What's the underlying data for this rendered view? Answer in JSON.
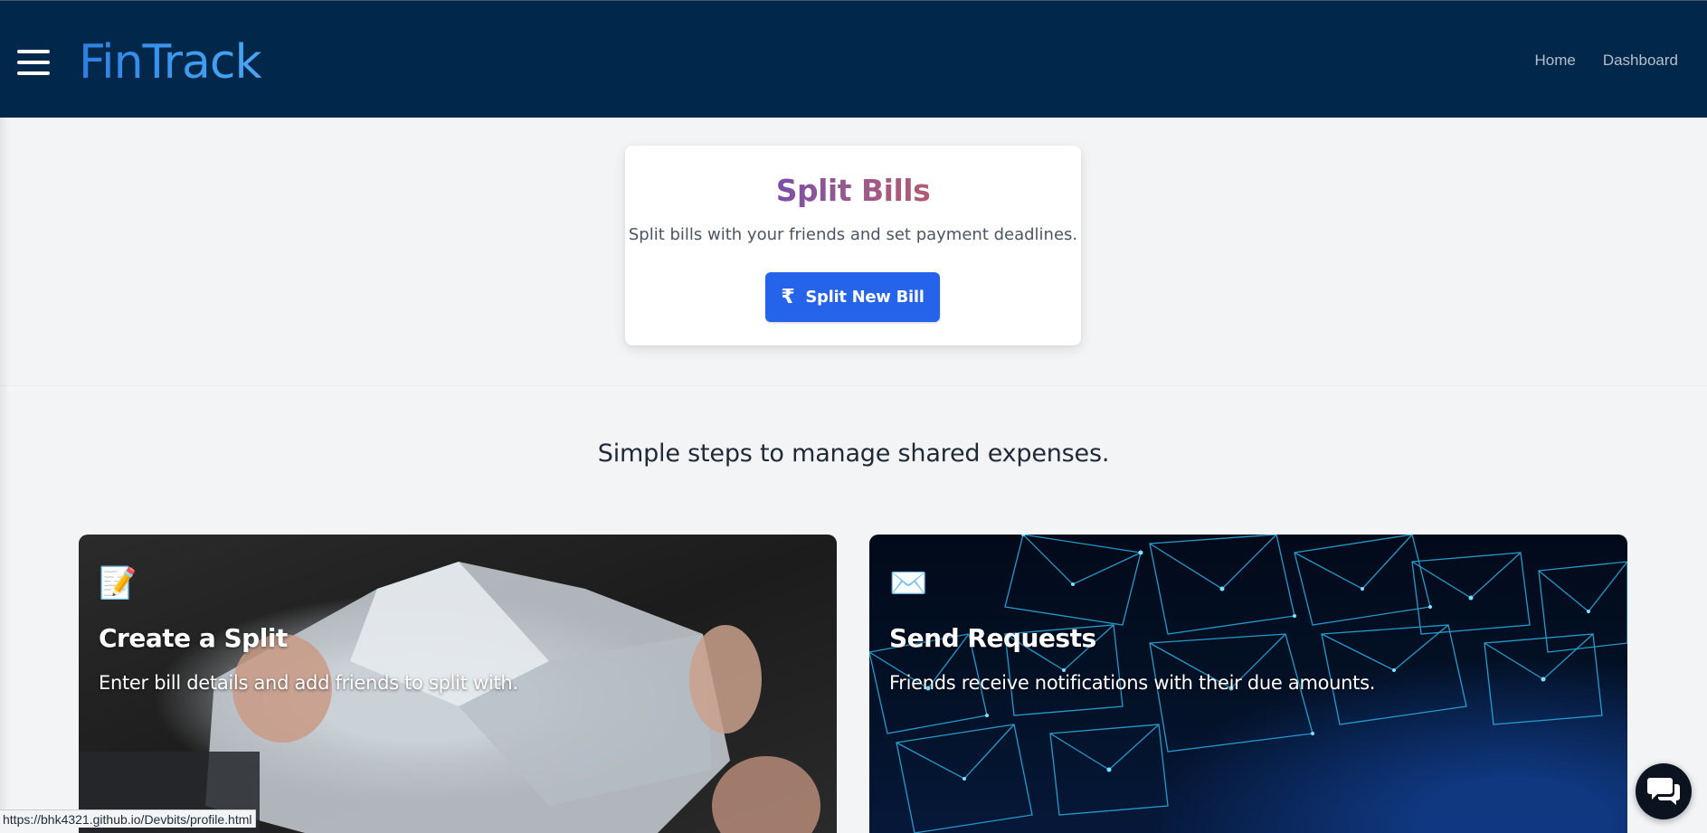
{
  "navbar": {
    "brand": "FinTrack",
    "links": [
      "Home",
      "Dashboard"
    ]
  },
  "split_card": {
    "title": "Split Bills",
    "description": "Split bills with your friends and set payment deadlines.",
    "button_icon": "₹",
    "button_label": "Split New Bill"
  },
  "steps": {
    "subtitle": "Simple steps to manage shared expenses.",
    "cards": [
      {
        "icon": "📝",
        "icon_name": "memo-icon",
        "title": "Create a Split",
        "description": "Enter bill details and add friends to split with."
      },
      {
        "icon": "✉️",
        "icon_name": "envelope-icon",
        "title": "Send Requests",
        "description": "Friends receive notifications with their due amounts."
      }
    ]
  },
  "status_bar": {
    "url": "https://bhk4321.github.io/Devbits/profile.html"
  },
  "chat": {
    "icon_name": "chat-icon"
  },
  "colors": {
    "navbar_bg": "#01284b",
    "primary_button": "#2563eb",
    "page_bg": "#f3f4f6"
  }
}
